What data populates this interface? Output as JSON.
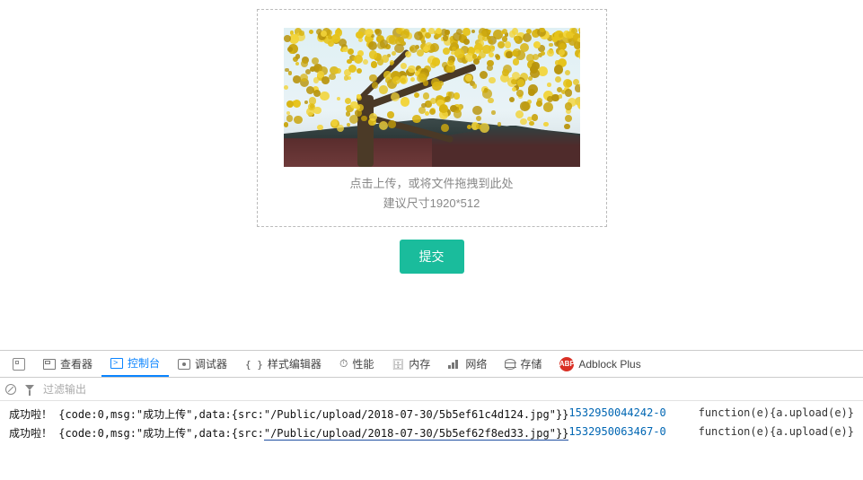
{
  "upload": {
    "hint_line1": "点击上传，或将文件拖拽到此处",
    "hint_line2": "建议尺寸1920*512",
    "submit_label": "提交"
  },
  "devtools": {
    "tabs": {
      "inspector": "查看器",
      "console": "控制台",
      "debugger": "调试器",
      "style": "样式编辑器",
      "performance": "性能",
      "memory": "内存",
      "network": "网络",
      "storage": "存储",
      "adblock": "Adblock Plus"
    },
    "abp_badge": "ABP",
    "filter_placeholder": "过滤输出"
  },
  "console": {
    "rows": [
      {
        "prefix": "成功啦！",
        "code": 0,
        "msg": "成功上传",
        "src": "/Public/upload/2018-07-30/5b5ef61c4d124.jpg",
        "time": "1532950044242-0",
        "fn": "function(e){a.upload(e)}",
        "highlight_src": false
      },
      {
        "prefix": "成功啦！",
        "code": 0,
        "msg": "成功上传",
        "src": "/Public/upload/2018-07-30/5b5ef62f8ed33.jpg",
        "time": "1532950063467-0",
        "fn": "function(e){a.upload(e)}",
        "highlight_src": true
      }
    ]
  }
}
